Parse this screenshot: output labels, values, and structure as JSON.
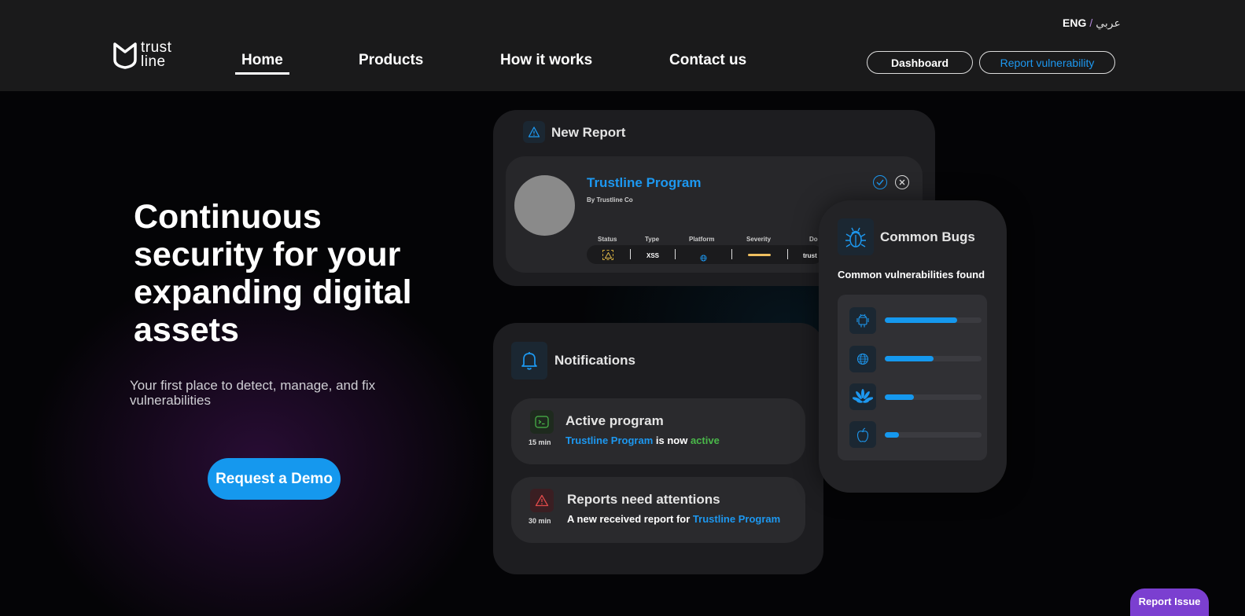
{
  "brand": {
    "logo_line1": "trust",
    "logo_line2": "line"
  },
  "lang": {
    "current": "ENG",
    "separator": "/",
    "alt": "عربي"
  },
  "nav": {
    "items": [
      {
        "label": "Home",
        "active": true
      },
      {
        "label": "Products"
      },
      {
        "label": "How it works"
      },
      {
        "label": "Contact us"
      }
    ],
    "dashboard_label": "Dashboard",
    "report_label": "Report vulnerability"
  },
  "hero": {
    "title_lines": [
      "Continuous",
      "security for your",
      "expanding digital",
      "assets"
    ],
    "subtitle": "Your first place to detect, manage, and fix vulnerabilities",
    "cta": "Request a Demo"
  },
  "new_report": {
    "title": "New Report",
    "program": "Trustline Program",
    "by": "By Trustline Co",
    "columns": [
      "Status",
      "Type",
      "Platform",
      "Severity",
      "Do"
    ],
    "type_value": "XSS",
    "domain_value": "trust"
  },
  "notifications": {
    "title": "Notifications",
    "items": [
      {
        "title": "Active program",
        "time": "15 min",
        "program": "Trustline Program",
        "middle": "is now",
        "status": "active"
      },
      {
        "title": "Reports need attentions",
        "time": "30 min",
        "prefix": "A new received report for",
        "program": "Trustline Program"
      }
    ]
  },
  "bugs": {
    "title": "Common Bugs",
    "subtitle": "Common vulnerabilities found",
    "rows": [
      {
        "icon": "android-icon",
        "level": 0.75
      },
      {
        "icon": "globe-icon",
        "level": 0.5
      },
      {
        "icon": "huawei-icon",
        "level": 0.3
      },
      {
        "icon": "apple-icon",
        "level": 0.15
      }
    ]
  },
  "report_issue": "Report Issue",
  "colors": {
    "accent": "#1598ee",
    "purple": "#7b3fd0",
    "active_green": "#4ab84a"
  }
}
